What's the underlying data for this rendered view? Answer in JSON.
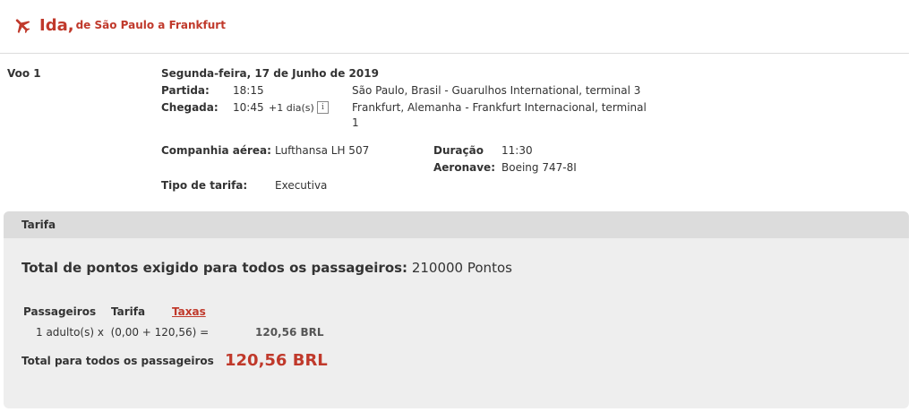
{
  "header": {
    "title": "Ida,",
    "subtitle": "de São Paulo a Frankfurt",
    "icon": "plane-icon",
    "accent_color": "#c0392b"
  },
  "flight": {
    "label": "Voo 1",
    "date": "Segunda-feira, 17 de Junho de 2019",
    "departure_label": "Partida:",
    "departure_time": "18:15",
    "departure_place": "São Paulo, Brasil - Guarulhos International, terminal 3",
    "arrival_label": "Chegada:",
    "arrival_time": "10:45",
    "arrival_day_offset": "+1 dia(s)",
    "arrival_place_line1": "Frankfurt, Alemanha - Frankfurt Internacional, terminal",
    "arrival_place_line2": "1",
    "info_icon": "i",
    "airline_label": "Companhia aérea:",
    "airline_value": "Lufthansa LH 507",
    "duration_label": "Duração",
    "duration_value": "11:30",
    "aircraft_label": "Aeronave:",
    "aircraft_value": "Boeing 747-8I",
    "fare_type_label": "Tipo de tarifa:",
    "fare_type_value": "Executiva"
  },
  "fare": {
    "section_title": "Tarifa",
    "total_points_label": "Total de pontos exigido para todos os passageiros:",
    "total_points_value": "210000 Pontos",
    "col_passengers": "Passageiros",
    "col_fare": "Tarifa",
    "col_taxes": "Taxas",
    "calc_expression": "1 adulto(s) x  (0,00 + 120,56) =",
    "calc_total": "120,56 BRL",
    "grand_total_label": "Total para todos os passageiros",
    "grand_total_value": "120,56 BRL"
  }
}
